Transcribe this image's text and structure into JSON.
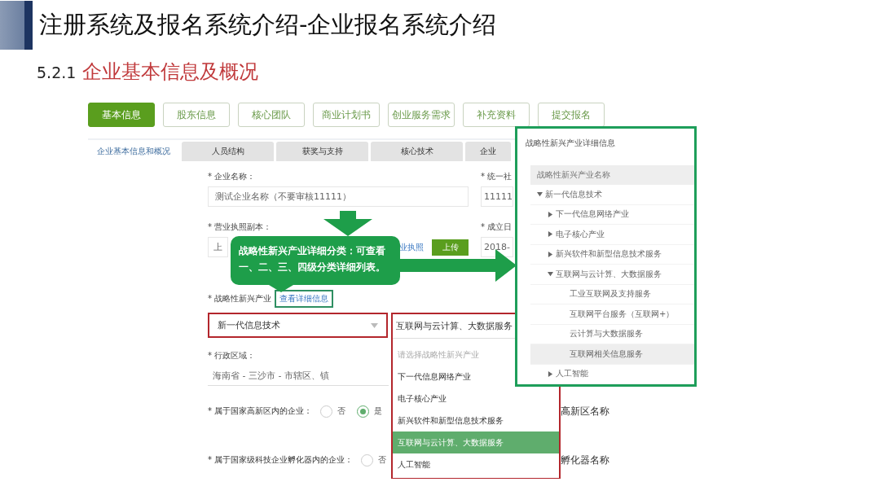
{
  "slide": {
    "title": "注册系统及报名系统介绍-企业报名系统介绍",
    "section_number": "5.2.1",
    "section_title": "企业基本信息及概况"
  },
  "step_tabs": [
    {
      "label": "基本信息",
      "selected": true
    },
    {
      "label": "股东信息",
      "selected": false
    },
    {
      "label": "核心团队",
      "selected": false
    },
    {
      "label": "商业计划书",
      "selected": false
    },
    {
      "label": "创业服务需求",
      "selected": false
    },
    {
      "label": "补充资料",
      "selected": false
    },
    {
      "label": "提交报名",
      "selected": false
    }
  ],
  "sub_tabs": [
    {
      "label": "企业基本信息和概况",
      "selected": true
    },
    {
      "label": "人员结构",
      "selected": false
    },
    {
      "label": "获奖与支持",
      "selected": false
    },
    {
      "label": "核心技术",
      "selected": false
    },
    {
      "label": "企业",
      "selected": false
    }
  ],
  "form": {
    "company_name": {
      "label": "* 企业名称：",
      "value": "测试企业名称（不要审核11111）"
    },
    "credit_code": {
      "label": "* 统一社",
      "value": "11111"
    },
    "license": {
      "label": "* 营业执照副本：",
      "placeholder": "上",
      "link": "业执照",
      "button": "上传"
    },
    "founded": {
      "label": "* 成立日",
      "value": "2018-"
    },
    "industry": {
      "label": "* 战略性新兴产业",
      "link": "查看详细信息",
      "value": "新一代信息技术",
      "sub_value": "互联网与云计算、大数据服务",
      "options": [
        {
          "label": "请选择战略性新兴产业",
          "disabled": true,
          "selected": false
        },
        {
          "label": "下一代信息网络产业",
          "disabled": false,
          "selected": false
        },
        {
          "label": "电子核心产业",
          "disabled": false,
          "selected": false
        },
        {
          "label": "新兴软件和新型信息技术服务",
          "disabled": false,
          "selected": false
        },
        {
          "label": "互联网与云计算、大数据服务",
          "disabled": false,
          "selected": true
        },
        {
          "label": "人工智能",
          "disabled": false,
          "selected": false
        }
      ]
    },
    "region": {
      "label": "* 行政区域：",
      "value": "海南省 - 三沙市 - 市辖区、镇"
    },
    "high_tech_zone": {
      "label": "* 属于国家高新区内的企业：",
      "side_label": "高新区名称",
      "options": [
        {
          "label": "否",
          "selected": false
        },
        {
          "label": "是",
          "selected": true
        }
      ]
    },
    "incubator": {
      "label": "* 属于国家级科技企业孵化器内的企业：",
      "side_label": "孵化器名称",
      "options": [
        {
          "label": "否",
          "selected": false
        }
      ]
    }
  },
  "callout": {
    "text": "战略性新兴产业详细分类：可查看一、二、三、四级分类详细列表。"
  },
  "detail_panel": {
    "title": "战略性新兴产业详细信息",
    "header": "战略性新兴产业名称",
    "tree": [
      {
        "label": "新一代信息技术",
        "expanded": true,
        "selected": false,
        "children": [
          {
            "label": "下一代信息网络产业",
            "expanded": false,
            "selected": false
          },
          {
            "label": "电子核心产业",
            "expanded": false,
            "selected": false
          },
          {
            "label": "新兴软件和新型信息技术服务",
            "expanded": false,
            "selected": false
          },
          {
            "label": "互联网与云计算、大数据服务",
            "expanded": true,
            "selected": false,
            "children": [
              {
                "label": "工业互联网及支持服务",
                "selected": false
              },
              {
                "label": "互联网平台服务（互联网+）",
                "selected": false
              },
              {
                "label": "云计算与大数据服务",
                "selected": false
              },
              {
                "label": "互联网相关信息服务",
                "selected": true
              }
            ]
          },
          {
            "label": "人工智能",
            "expanded": false,
            "selected": false
          }
        ]
      }
    ]
  }
}
